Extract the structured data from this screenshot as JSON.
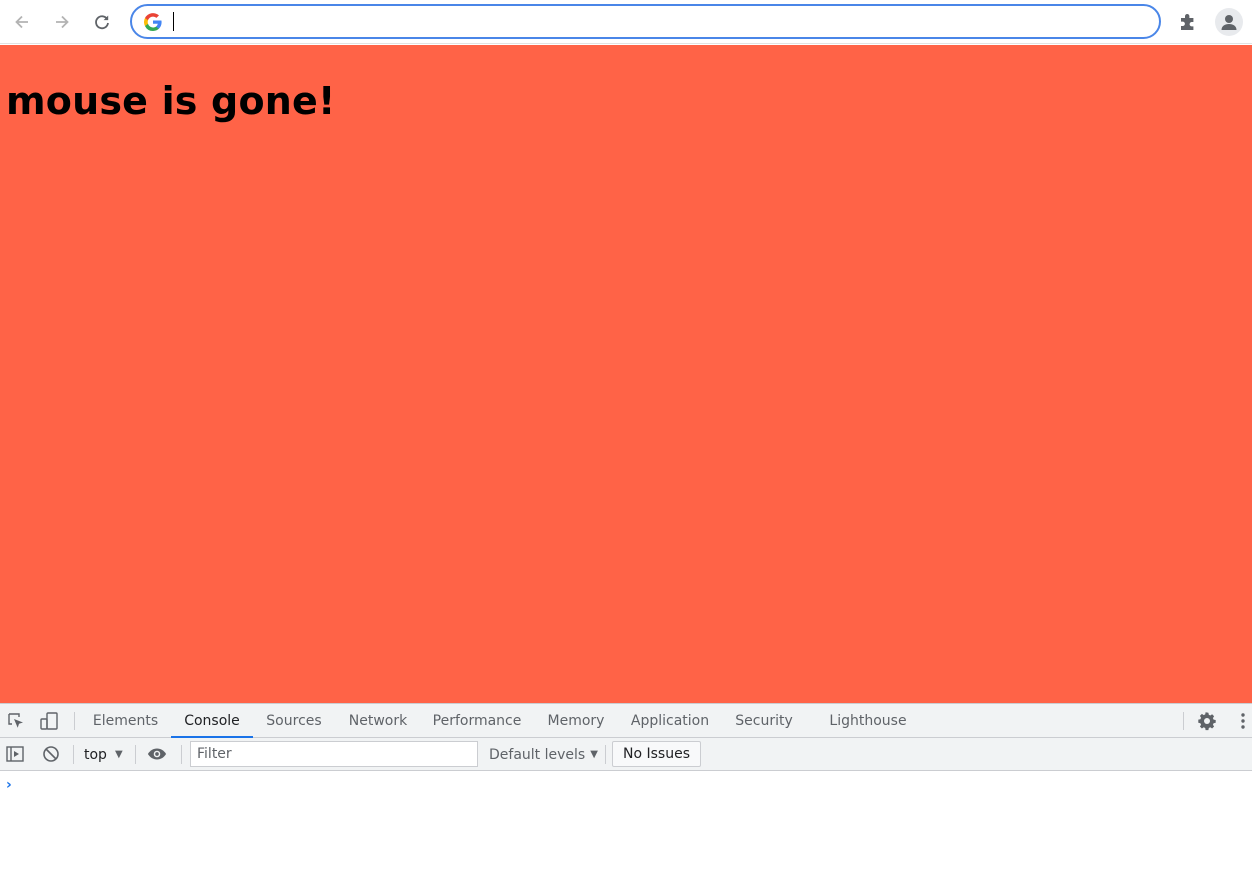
{
  "browser": {
    "omnibox": {
      "value": "",
      "placeholder": ""
    },
    "icons": {
      "back": "back-arrow-icon",
      "forward": "forward-arrow-icon",
      "reload": "reload-icon",
      "google": "google-g-icon",
      "extensions": "puzzle-piece-icon",
      "profile": "profile-avatar-icon"
    }
  },
  "page": {
    "heading": "mouse is gone!",
    "background_color": "#ff6347"
  },
  "devtools": {
    "tabs": [
      {
        "label": "Elements",
        "active": false
      },
      {
        "label": "Console",
        "active": true
      },
      {
        "label": "Sources",
        "active": false
      },
      {
        "label": "Network",
        "active": false
      },
      {
        "label": "Performance",
        "active": false
      },
      {
        "label": "Memory",
        "active": false
      },
      {
        "label": "Application",
        "active": false
      },
      {
        "label": "Security",
        "active": false
      },
      {
        "label": "Lighthouse",
        "active": false
      }
    ],
    "console": {
      "context": "top",
      "filter_placeholder": "Filter",
      "levels": "Default levels",
      "issues": "No Issues",
      "prompt_symbol": "›"
    },
    "accent_color": "#1a73e8"
  }
}
